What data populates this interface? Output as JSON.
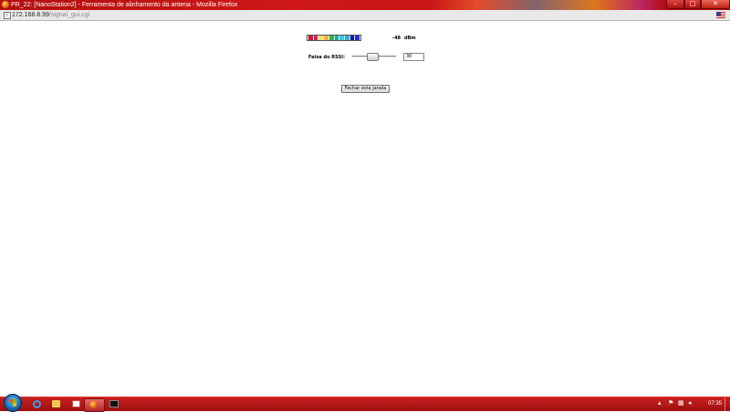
{
  "window": {
    "title": "PR_22: [NanoStation2] - Ferramenta de alinhamento da antena - Mozilla Firefox",
    "buttons": {
      "minimize": "–",
      "maximize": "□",
      "close": "✕"
    }
  },
  "address_bar": {
    "host": "172.168.8.99",
    "path": "/signal_gui.cgi"
  },
  "signal": {
    "segments": [
      "#c41a3a",
      "#d81b60",
      "#f7e25a",
      "#f6b13a",
      "#31b04b",
      "#1ea9a0",
      "#2fc9e8",
      "#35a8e0",
      "#0a1a9c",
      "#1e2fd6"
    ],
    "dbm_value": "-48",
    "dbm_unit": "dBm"
  },
  "rssi": {
    "label": "Faixa do RSSI:",
    "slider_level": 0.45,
    "value": "30"
  },
  "close_button": {
    "label": "Fechar esta janela"
  },
  "taskbar": {
    "items": [
      "internet-explorer-icon",
      "folder-icon",
      "media-player-icon",
      "firefox-icon",
      "command-prompt-icon"
    ],
    "tray": {
      "icons": [
        "arrow-up-icon",
        "flag-icon",
        "network-icon",
        "volume-icon"
      ],
      "time": "07:35"
    }
  }
}
